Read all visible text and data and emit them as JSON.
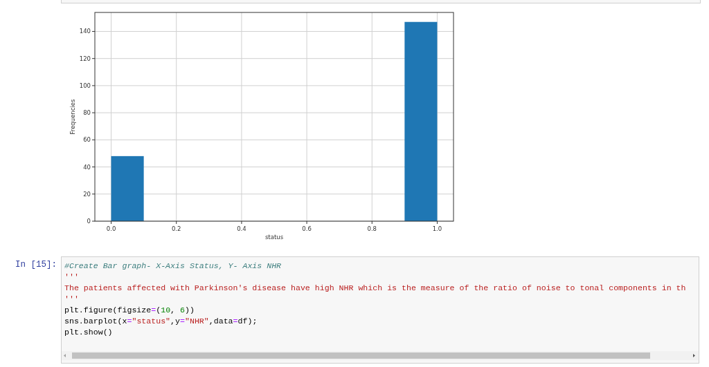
{
  "output_chart": {
    "chart_data": {
      "type": "bar",
      "xlabel": "status",
      "ylabel": "Frequencies",
      "x": [
        0.05,
        0.95
      ],
      "grid": true,
      "series": [
        {
          "color": "#1f77b4",
          "values": [
            48,
            147
          ]
        }
      ],
      "xlim": [
        -0.05,
        1.05
      ],
      "ylim": [
        0,
        154
      ],
      "xticks": [
        {
          "value": 0,
          "label": "0.0"
        },
        {
          "value": 0.2,
          "label": "0.2"
        },
        {
          "value": 0.4,
          "label": "0.4"
        },
        {
          "value": 0.6,
          "label": "0.6"
        },
        {
          "value": 0.8,
          "label": "0.8"
        },
        {
          "value": 1,
          "label": "1.0"
        }
      ],
      "yticks": [
        0,
        20,
        40,
        60,
        80,
        100,
        120,
        140
      ]
    }
  },
  "cell": {
    "prompt": "In [15]:",
    "lines": [
      [
        {
          "kind": "comment",
          "text": "#Create Bar graph- X-Axis Status, Y- Axis NHR"
        }
      ],
      [
        {
          "kind": "string",
          "text": "'''"
        }
      ],
      [
        {
          "kind": "string",
          "text": "The patients affected with Parkinson's disease have high NHR which is the measure of the ratio of noise to tonal components in th"
        }
      ],
      [
        {
          "kind": "string",
          "text": "'''"
        }
      ],
      [
        {
          "kind": "plain",
          "text": "plt.figure(figsize"
        },
        {
          "kind": "operator",
          "text": "="
        },
        {
          "kind": "plain",
          "text": "("
        },
        {
          "kind": "number",
          "text": "10"
        },
        {
          "kind": "plain",
          "text": ", "
        },
        {
          "kind": "number",
          "text": "6"
        },
        {
          "kind": "plain",
          "text": "))"
        }
      ],
      [
        {
          "kind": "plain",
          "text": "sns.barplot(x"
        },
        {
          "kind": "operator",
          "text": "="
        },
        {
          "kind": "string",
          "text": "\"status\""
        },
        {
          "kind": "plain",
          "text": ",y"
        },
        {
          "kind": "operator",
          "text": "="
        },
        {
          "kind": "string",
          "text": "\"NHR\""
        },
        {
          "kind": "plain",
          "text": ",data"
        },
        {
          "kind": "operator",
          "text": "="
        },
        {
          "kind": "plain",
          "text": "df);"
        }
      ],
      [
        {
          "kind": "plain",
          "text": "plt.show()"
        }
      ]
    ]
  }
}
